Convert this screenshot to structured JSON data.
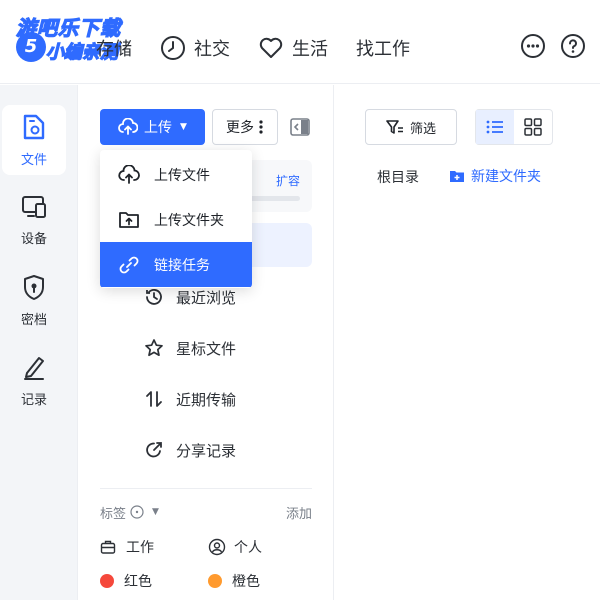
{
  "watermark": {
    "line1": "游吧乐下载",
    "line2": "小编亲测",
    "badge": "5"
  },
  "topnav": {
    "storage": "存储",
    "social": "社交",
    "life": "生活",
    "jobs": "找工作"
  },
  "rail": {
    "files": "文件",
    "devices": "设备",
    "vault": "密档",
    "records": "记录"
  },
  "sidebar": {
    "upload_label": "上传",
    "more_label": "更多",
    "expand_label": "扩容",
    "storage_fill": 0.06,
    "nav": {
      "recent": "最近浏览",
      "starred": "星标文件",
      "transfers": "近期传输",
      "shares": "分享记录"
    },
    "tags": {
      "header": "标签",
      "add": "添加",
      "work": "工作",
      "personal": "个人",
      "red": "红色",
      "orange": "橙色"
    }
  },
  "dropdown": {
    "upload_file": "上传文件",
    "upload_folder": "上传文件夹",
    "link_task": "链接任务"
  },
  "main": {
    "filter_label": "筛选",
    "breadcrumb": "根目录",
    "new_folder": "新建文件夹"
  },
  "colors": {
    "accent": "#2f6bff",
    "tag_red": "#f5483b",
    "tag_orange": "#ff9a2e"
  }
}
